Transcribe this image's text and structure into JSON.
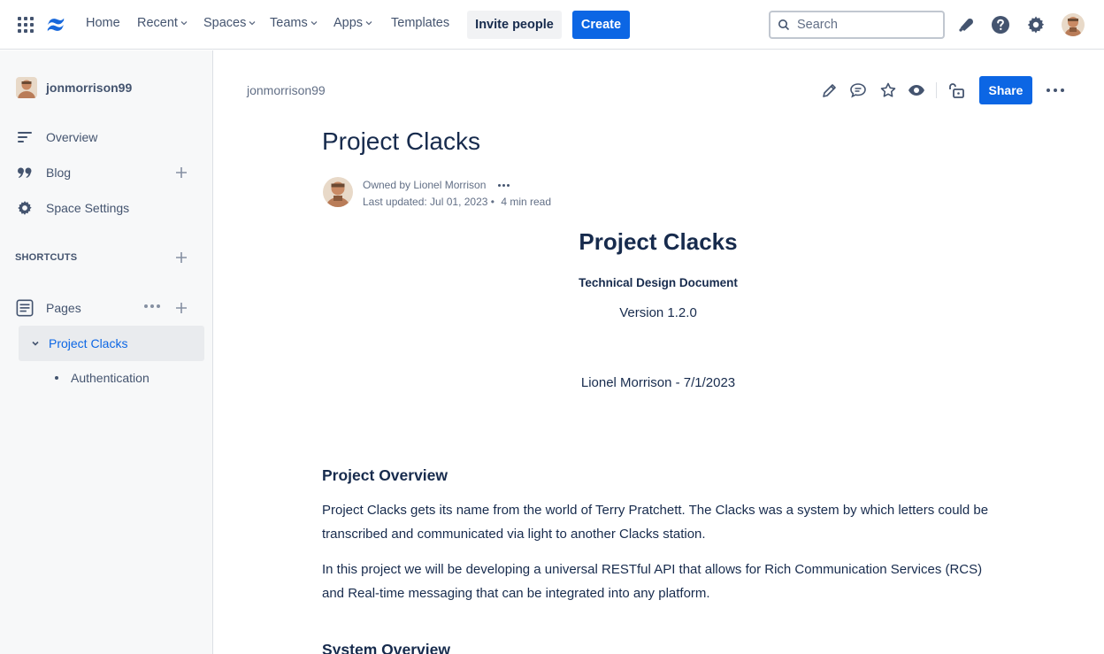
{
  "topnav": {
    "items": [
      {
        "label": "Home",
        "dropdown": false
      },
      {
        "label": "Recent",
        "dropdown": true
      },
      {
        "label": "Spaces",
        "dropdown": true
      },
      {
        "label": "Teams",
        "dropdown": true
      },
      {
        "label": "Apps",
        "dropdown": true
      },
      {
        "label": "Templates",
        "dropdown": false
      }
    ],
    "invite_label": "Invite people",
    "create_label": "Create",
    "search_placeholder": "Search",
    "icons": [
      "app-switcher-icon",
      "confluence-logo-icon",
      "notifications-icon",
      "help-icon",
      "settings-icon",
      "profile-avatar"
    ],
    "accent_color": "#0c66e4"
  },
  "sidebar": {
    "space_name": "jonmorrison99",
    "items": [
      {
        "label": "Overview",
        "icon": "overview-icon"
      },
      {
        "label": "Blog",
        "icon": "blog-quote-icon"
      },
      {
        "label": "Space Settings",
        "icon": "settings-icon"
      }
    ],
    "shortcuts_label": "SHORTCUTS",
    "pages_label": "Pages",
    "tree": {
      "selected": "Project Clacks",
      "children": [
        "Authentication"
      ]
    }
  },
  "page": {
    "breadcrumb": "jonmorrison99",
    "share_label": "Share",
    "tool_icons": [
      "edit-icon",
      "comment-icon",
      "star-icon",
      "watch-icon",
      "restrictions-icon",
      "more-actions-icon"
    ],
    "title": "Project Clacks",
    "owned_by": "Owned by Lionel Morrison",
    "last_updated": "Last updated: Jul 01, 2023 •",
    "read_time": "4 min read",
    "doc_title": "Project Clacks",
    "doc_subtitle": "Technical Design Document",
    "doc_version": "Version 1.2.0",
    "doc_author": "Lionel Morrison - 7/1/2023",
    "sections": [
      {
        "heading": "Project Overview",
        "paragraphs": [
          "Project Clacks gets its name from the world of Terry Pratchett. The Clacks was a system by which letters could be transcribed and communicated via light to another Clacks station.",
          "In this project we will be developing a universal RESTful API that allows for Rich Communication Services (RCS) and Real-time messaging that can be integrated into any platform."
        ]
      },
      {
        "heading": "System Overview",
        "paragraphs": []
      }
    ]
  }
}
